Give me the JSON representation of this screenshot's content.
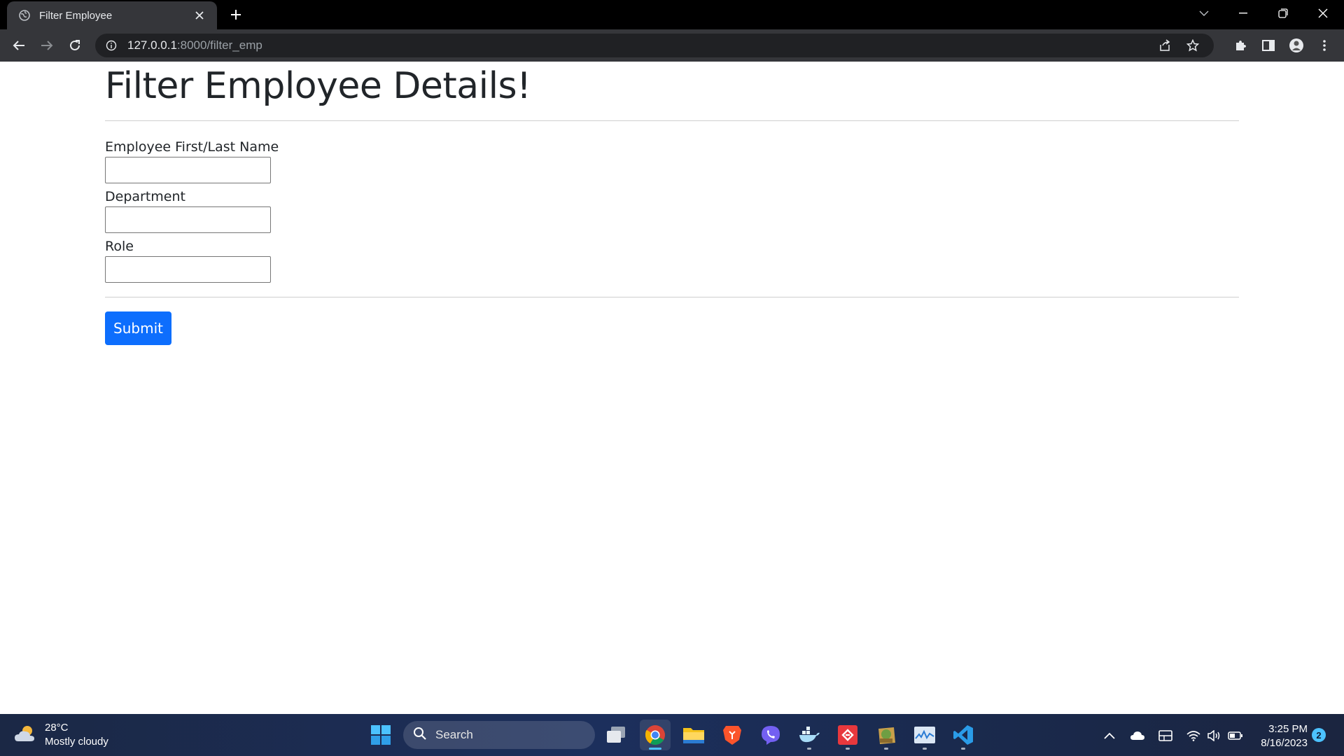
{
  "browser": {
    "tab_title": "Filter Employee",
    "url_host": "127.0.0.1",
    "url_path": ":8000/filter_emp"
  },
  "page": {
    "title": "Filter Employee Details!",
    "fields": [
      {
        "label": "Employee First/Last Name",
        "value": ""
      },
      {
        "label": "Department",
        "value": ""
      },
      {
        "label": "Role",
        "value": ""
      }
    ],
    "submit_label": "Submit",
    "accent_color": "#0d6efd"
  },
  "taskbar": {
    "weather_temp": "28°C",
    "weather_desc": "Mostly cloudy",
    "search_placeholder": "Search",
    "time": "3:25 PM",
    "date": "8/16/2023",
    "notification_count": "2",
    "apps": [
      "task-view",
      "chrome",
      "file-explorer",
      "brave",
      "viber",
      "docker",
      "git-tool",
      "gimp",
      "resource-monitor",
      "vscode"
    ]
  }
}
